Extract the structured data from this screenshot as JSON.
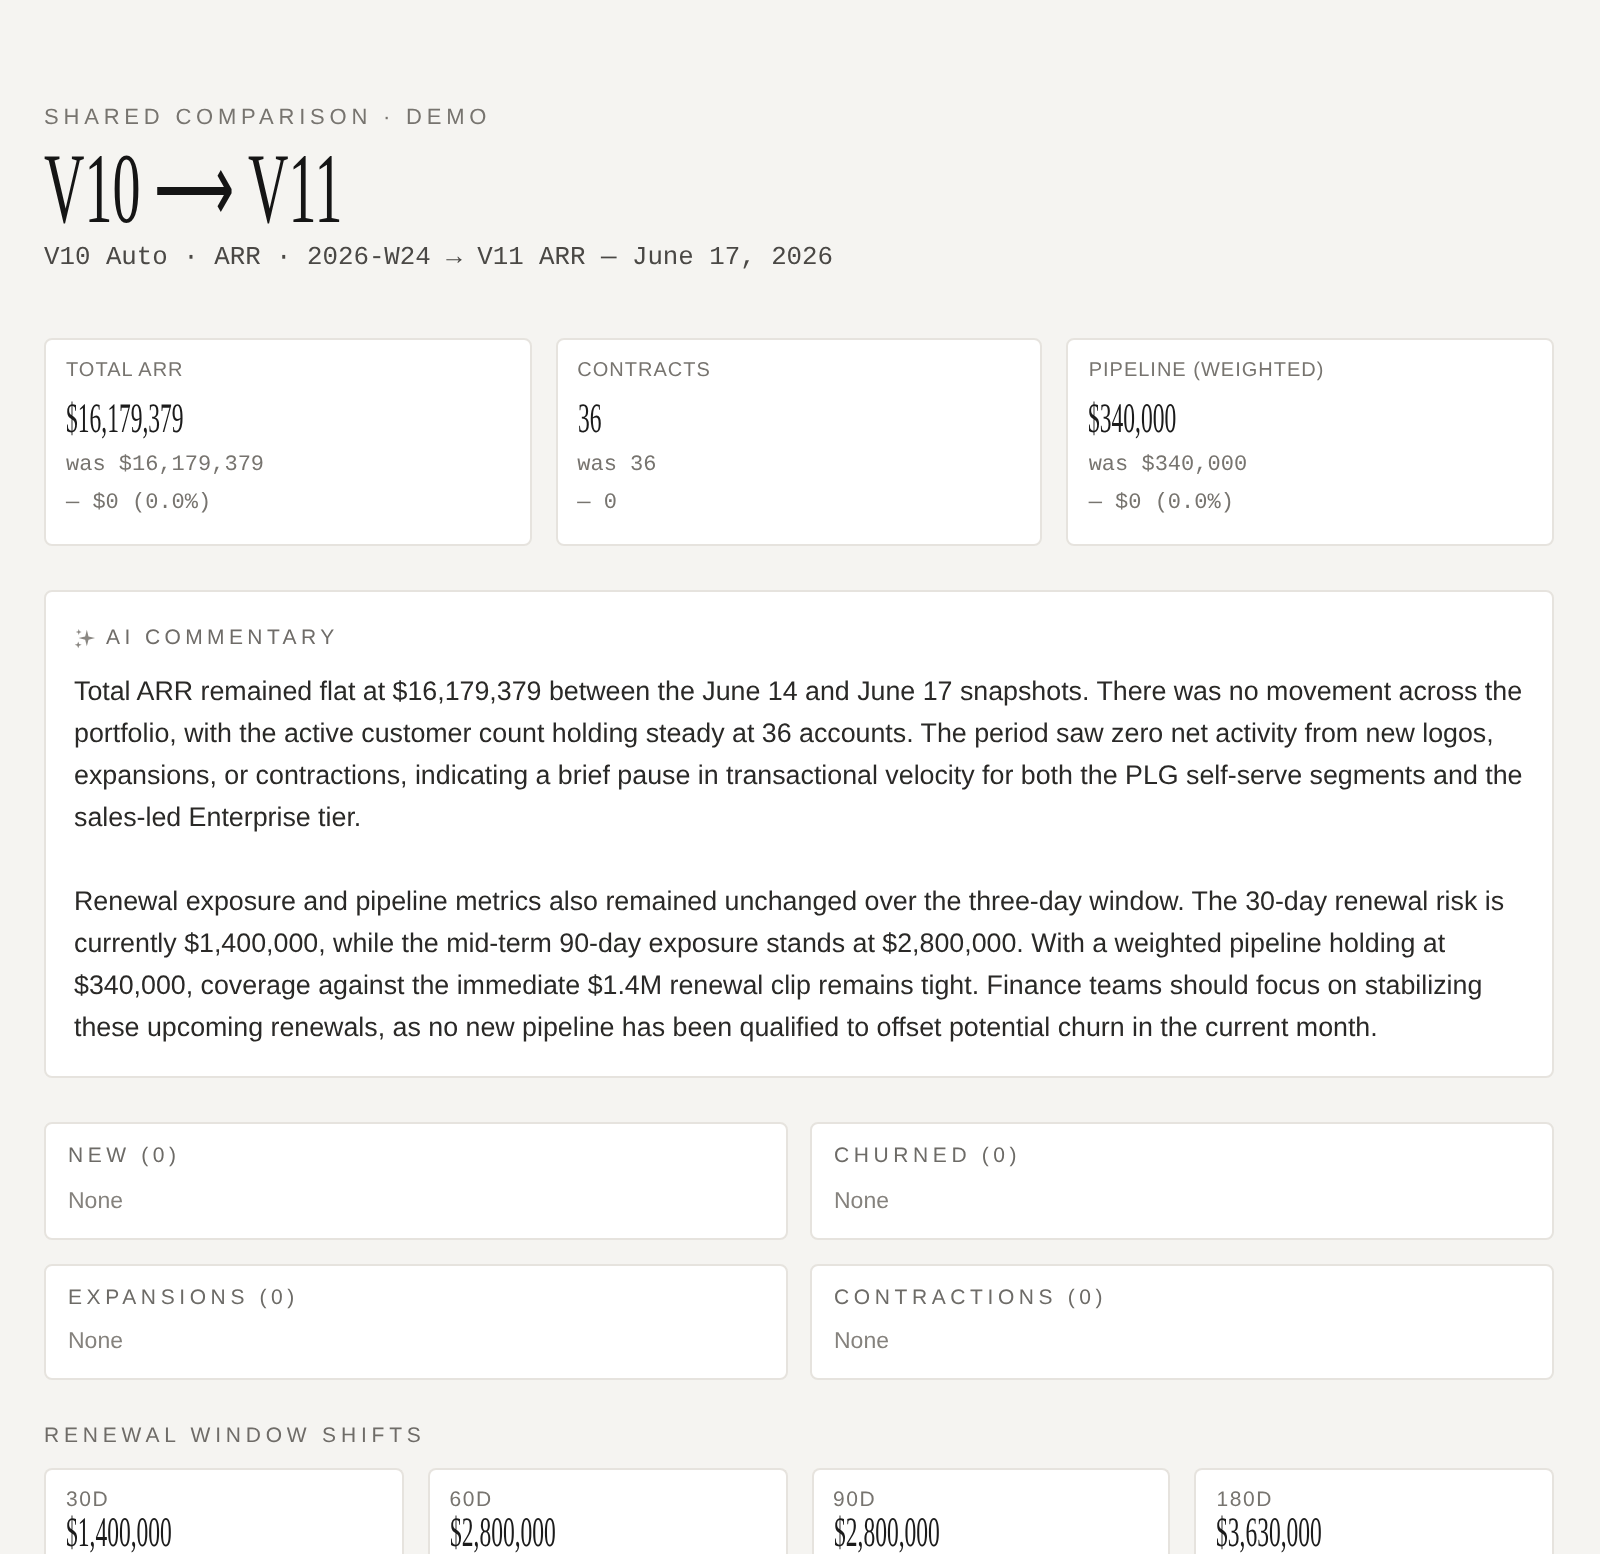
{
  "header": {
    "eyebrow": "SHARED COMPARISON · DEMO",
    "title": "V10 ⟶ V11",
    "subtitle": "V10 Auto · ARR · 2026-W24 → V11 ARR — June 17, 2026"
  },
  "metrics": [
    {
      "label": "TOTAL ARR",
      "value": "$16,179,379",
      "previous": "was $16,179,379",
      "change": "— $0 (0.0%)"
    },
    {
      "label": "CONTRACTS",
      "value": "36",
      "previous": "was 36",
      "change": "— 0"
    },
    {
      "label": "PIPELINE (WEIGHTED)",
      "value": "$340,000",
      "previous": "was $340,000",
      "change": "— $0 (0.0%)"
    }
  ],
  "commentary": {
    "heading": "AI COMMENTARY",
    "paragraphs": [
      "Total ARR remained flat at $16,179,379 between the June 14 and June 17 snapshots. There was no movement across the portfolio, with the active customer count holding steady at 36 accounts. The period saw zero net activity from new logos, expansions, or contractions, indicating a brief pause in transactional velocity for both the PLG self-serve segments and the sales-led Enterprise tier.",
      "Renewal exposure and pipeline metrics also remained unchanged over the three-day window. The 30-day renewal risk is currently $1,400,000, while the mid-term 90-day exposure stands at $2,800,000. With a weighted pipeline holding at $340,000, coverage against the immediate $1.4M renewal clip remains tight. Finance teams should focus on stabilizing these upcoming renewals, as no new pipeline has been qualified to offset potential churn in the current month."
    ]
  },
  "changes": [
    {
      "label": "NEW (0)",
      "value": "None"
    },
    {
      "label": "CHURNED (0)",
      "value": "None"
    },
    {
      "label": "EXPANSIONS (0)",
      "value": "None"
    },
    {
      "label": "CONTRACTIONS (0)",
      "value": "None"
    }
  ],
  "renewal_windows": {
    "heading": "RENEWAL WINDOW SHIFTS",
    "items": [
      {
        "label": "30D",
        "value": "$1,400,000"
      },
      {
        "label": "60D",
        "value": "$2,800,000"
      },
      {
        "label": "90D",
        "value": "$2,800,000"
      },
      {
        "label": "180D",
        "value": "$3,630,000"
      }
    ]
  }
}
